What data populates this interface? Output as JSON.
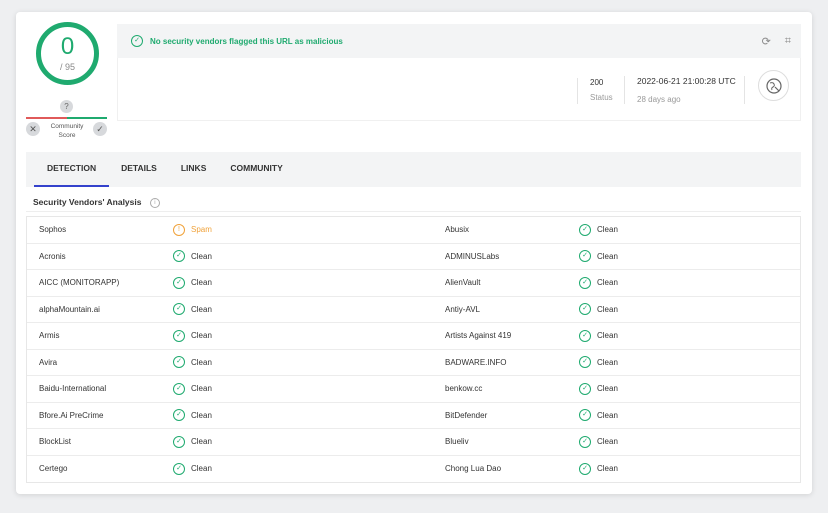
{
  "score": {
    "value": "0",
    "total": "/ 95"
  },
  "community": {
    "badge": "?",
    "label": "Community Score"
  },
  "alert": {
    "message": "No security vendors flagged this URL as malicious"
  },
  "stats": {
    "status_value": "200",
    "status_label": "Status",
    "date_value": "2022-06-21 21:00:28 UTC",
    "date_label": "28 days ago"
  },
  "tabs": [
    "DETECTION",
    "DETAILS",
    "LINKS",
    "COMMUNITY"
  ],
  "section": {
    "title": "Security Vendors' Analysis"
  },
  "rows": [
    {
      "v1": "Sophos",
      "r1": "Spam",
      "r1_type": "warn",
      "v2": "Abusix",
      "r2": "Clean"
    },
    {
      "v1": "Acronis",
      "r1": "Clean",
      "r1_type": "clean",
      "v2": "ADMINUSLabs",
      "r2": "Clean"
    },
    {
      "v1": "AICC (MONITORAPP)",
      "r1": "Clean",
      "r1_type": "clean",
      "v2": "AlienVault",
      "r2": "Clean"
    },
    {
      "v1": "alphaMountain.ai",
      "r1": "Clean",
      "r1_type": "clean",
      "v2": "Antiy-AVL",
      "r2": "Clean"
    },
    {
      "v1": "Armis",
      "r1": "Clean",
      "r1_type": "clean",
      "v2": "Artists Against 419",
      "r2": "Clean"
    },
    {
      "v1": "Avira",
      "r1": "Clean",
      "r1_type": "clean",
      "v2": "BADWARE.INFO",
      "r2": "Clean"
    },
    {
      "v1": "Baidu-International",
      "r1": "Clean",
      "r1_type": "clean",
      "v2": "benkow.cc",
      "r2": "Clean"
    },
    {
      "v1": "Bfore.Ai PreCrime",
      "r1": "Clean",
      "r1_type": "clean",
      "v2": "BitDefender",
      "r2": "Clean"
    },
    {
      "v1": "BlockList",
      "r1": "Clean",
      "r1_type": "clean",
      "v2": "Blueliv",
      "r2": "Clean"
    },
    {
      "v1": "Certego",
      "r1": "Clean",
      "r1_type": "clean",
      "v2": "Chong Lua Dao",
      "r2": "Clean"
    }
  ],
  "colors": {
    "accent": "#1faa6f",
    "warn": "#f0a23a",
    "tab_underline": "#3442cc",
    "danger": "#e05a5a"
  }
}
